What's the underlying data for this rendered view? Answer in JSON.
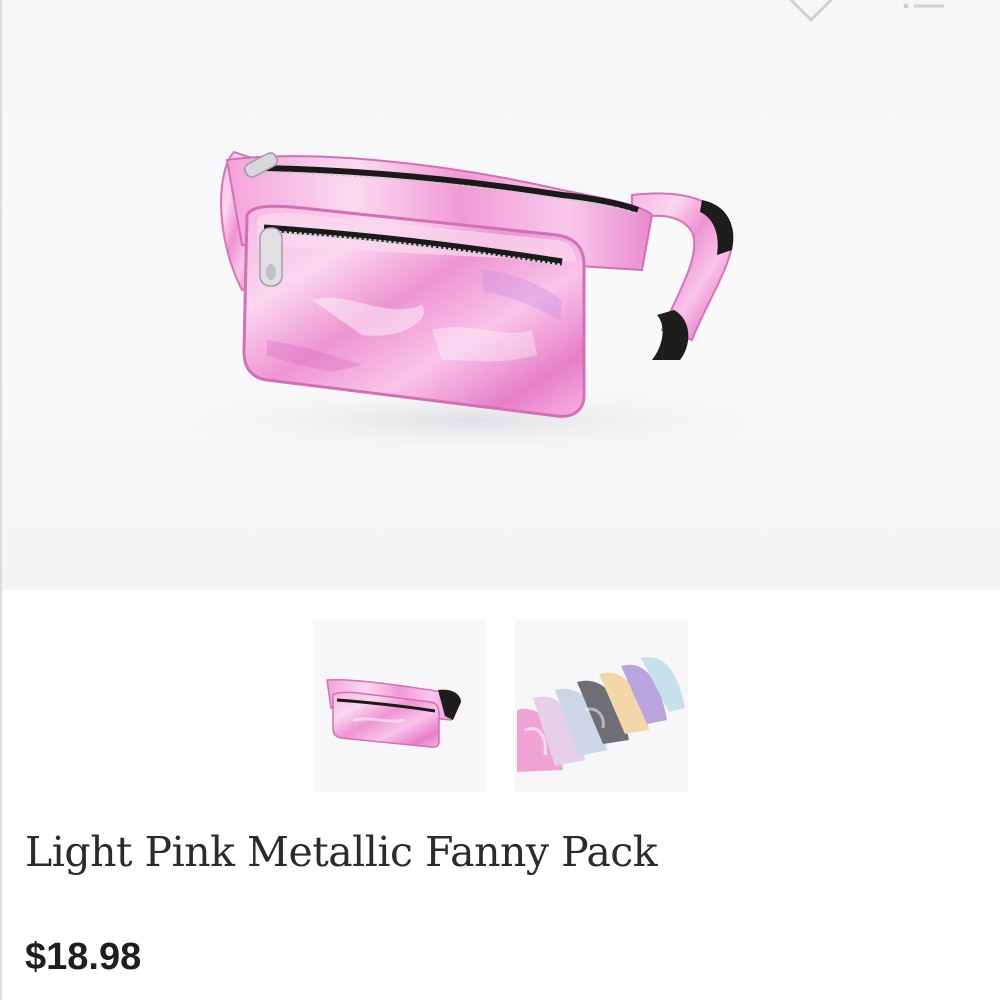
{
  "product": {
    "title": "Light Pink Metallic Fanny Pack",
    "price": "$18.98"
  },
  "icons": {
    "favorite": "heart-icon",
    "menu": "list-menu-icon"
  },
  "gallery": {
    "main_image": "light-pink-metallic-fanny-pack",
    "thumbnails": [
      {
        "name": "thumbnail-pink-fanny-pack",
        "selected": true
      },
      {
        "name": "thumbnail-color-variants",
        "selected": false
      }
    ]
  },
  "colors": {
    "pink_main": "#f4a8d8",
    "pink_light": "#fbd3ee",
    "pink_dark": "#e277c4",
    "text": "#2b2b2b"
  }
}
